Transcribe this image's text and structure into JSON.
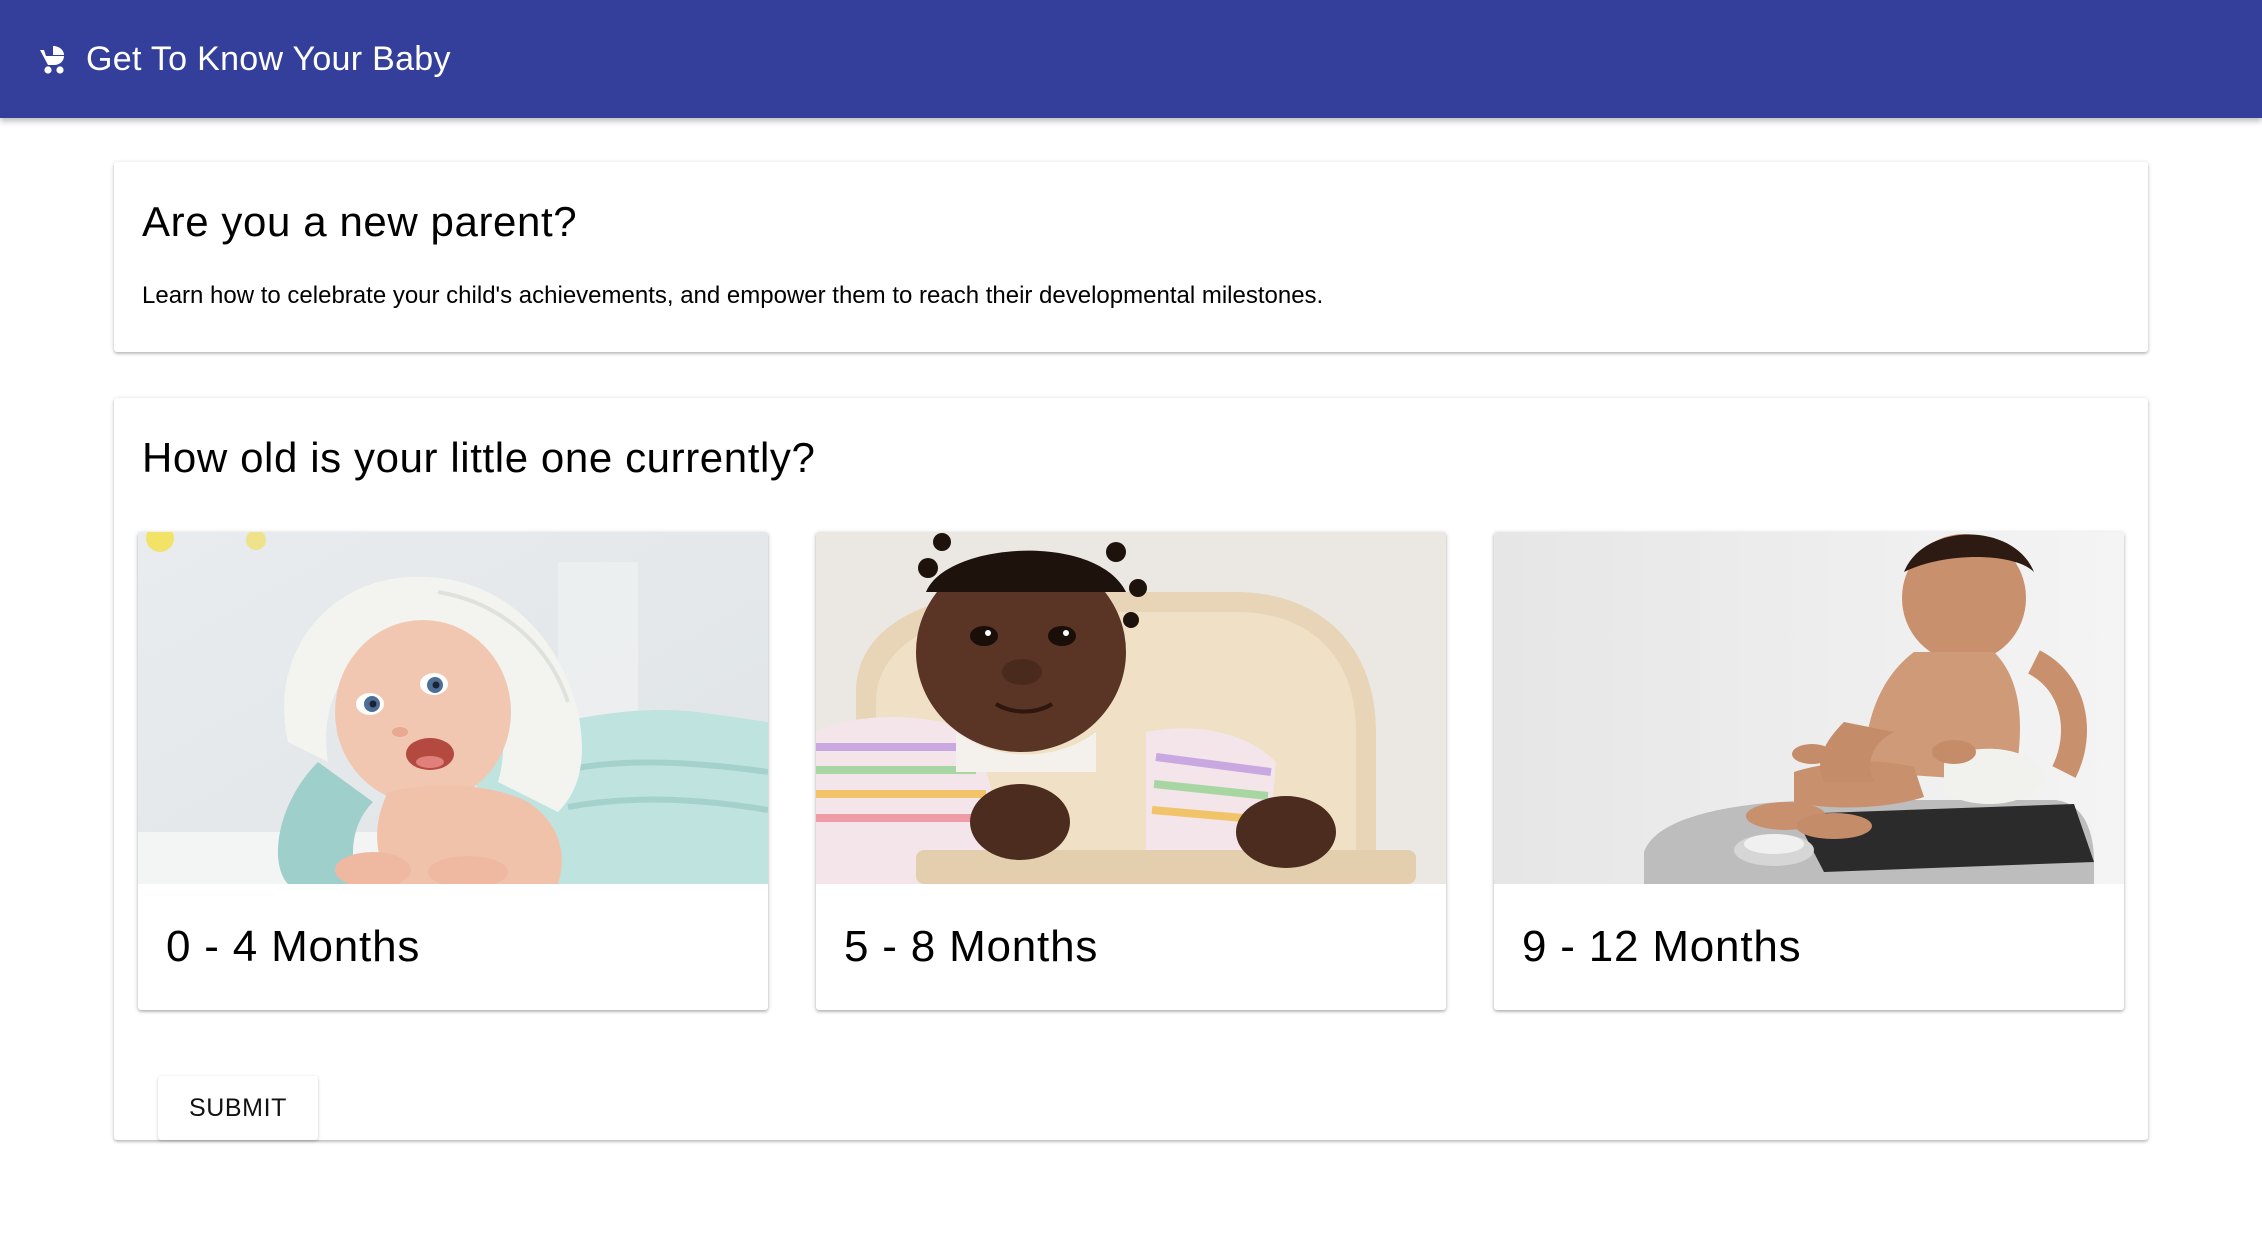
{
  "app_bar": {
    "title": "Get To Know Your Baby",
    "icon": "baby-stroller-icon",
    "color": "#343f9b"
  },
  "intro": {
    "heading": "Are you a new parent?",
    "text": "Learn how to celebrate your child's achievements, and empower them to reach their developmental milestones."
  },
  "age_question": {
    "heading": "How old is your little one currently?",
    "options": [
      {
        "label": "0 - 4 Months",
        "image": "baby-with-towel-hood-photo"
      },
      {
        "label": "5 - 8 Months",
        "image": "baby-in-high-chair-photo"
      },
      {
        "label": "9 - 12 Months",
        "image": "baby-on-scale-photo"
      }
    ],
    "submit_label": "SUBMIT"
  }
}
